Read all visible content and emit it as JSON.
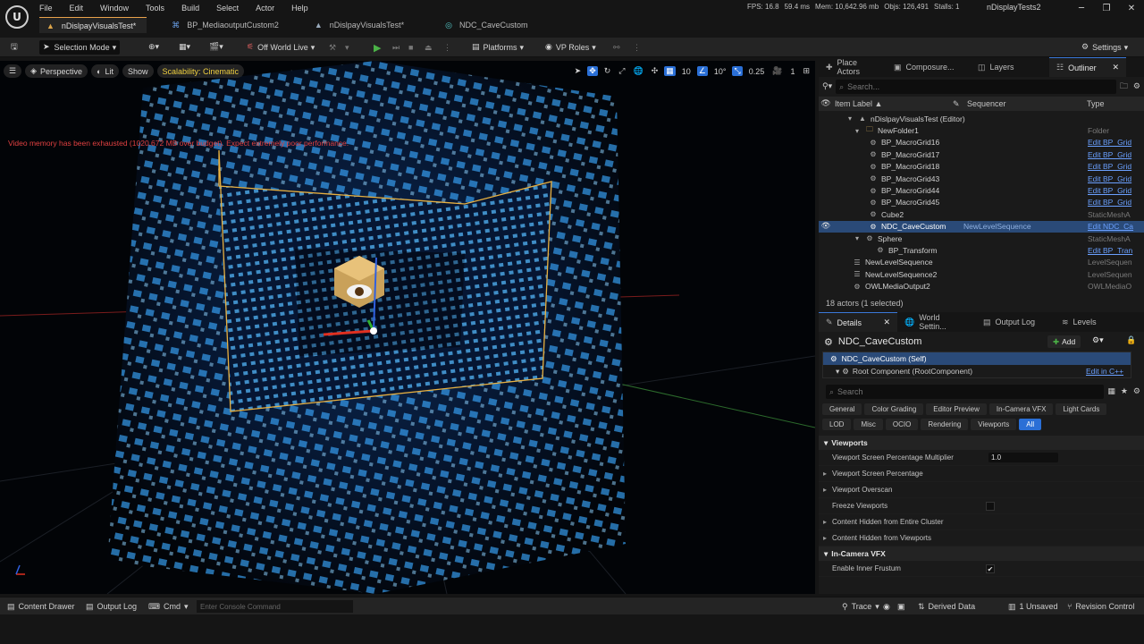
{
  "app": {
    "menu": [
      "File",
      "Edit",
      "Window",
      "Tools",
      "Build",
      "Select",
      "Actor",
      "Help"
    ],
    "stats": {
      "fps": "FPS: 16.8",
      "ms": "59.4 ms",
      "mem": "Mem: 10,642.96 mb",
      "objs": "Objs: 126,491",
      "stalls": "Stalls: 1"
    },
    "project_name": "nDisplayTests2",
    "tabs": [
      {
        "label": "nDislpayVisualsTest*",
        "active": true
      },
      {
        "label": "BP_MediaoutputCustom2",
        "active": false
      },
      {
        "label": "nDislpayVisualsTest*",
        "active": false
      },
      {
        "label": "NDC_CaveCustom",
        "active": false
      }
    ]
  },
  "toolbar": {
    "selection_mode": "Selection Mode",
    "world_live": "Off World Live",
    "platforms": "Platforms",
    "vp_roles": "VP Roles",
    "settings": "Settings"
  },
  "viewport": {
    "perspective": "Perspective",
    "lit": "Lit",
    "show": "Show",
    "scalability": "Scalability: Cinematic",
    "grid_snap": "10",
    "rot_snap": "10°",
    "scale_snap": "0.25",
    "cam_speed": "1",
    "warning": "Video memory has been exhausted (1020.672 MB over budget). Expect extremely poor performance."
  },
  "outliner": {
    "tabs": [
      "Place Actors",
      "Composure...",
      "Layers",
      "Outliner"
    ],
    "search_placeholder": "Search...",
    "col_label": "Item Label",
    "col_sequencer": "Sequencer",
    "col_type": "Type",
    "rows": [
      {
        "label": "nDislpayVisualsTest (Editor)",
        "type": "",
        "link": false
      },
      {
        "label": "NewFolder1",
        "type": "Folder",
        "link": false
      },
      {
        "label": "BP_MacroGrid16",
        "type": "Edit BP_Grid",
        "link": true
      },
      {
        "label": "BP_MacroGrid17",
        "type": "Edit BP_Grid",
        "link": true
      },
      {
        "label": "BP_MacroGrid18",
        "type": "Edit BP_Grid",
        "link": true
      },
      {
        "label": "BP_MacroGrid43",
        "type": "Edit BP_Grid",
        "link": true
      },
      {
        "label": "BP_MacroGrid44",
        "type": "Edit BP_Grid",
        "link": true
      },
      {
        "label": "BP_MacroGrid45",
        "type": "Edit BP_Grid",
        "link": true
      },
      {
        "label": "Cube2",
        "type": "StaticMeshA",
        "link": false
      },
      {
        "label": "NDC_CaveCustom",
        "type": "Edit NDC_Ca",
        "link": true,
        "sequencer": "NewLevelSequence"
      },
      {
        "label": "Sphere",
        "type": "StaticMeshA",
        "link": false
      },
      {
        "label": "BP_Transform",
        "type": "Edit BP_Tran",
        "link": true
      },
      {
        "label": "NewLevelSequence",
        "type": "LevelSequen",
        "link": false
      },
      {
        "label": "NewLevelSequence2",
        "type": "LevelSequen",
        "link": false
      },
      {
        "label": "OWLMediaOutput2",
        "type": "OWLMediaO",
        "link": false
      }
    ],
    "footer": "18 actors (1 selected)"
  },
  "details": {
    "tabs": [
      "Details",
      "World Settin...",
      "Output Log",
      "Levels"
    ],
    "title": "NDC_CaveCustom",
    "add_label": "Add",
    "components": [
      {
        "label": "NDC_CaveCustom (Self)"
      },
      {
        "label": "Root Component (RootComponent)",
        "action": "Edit in C++"
      }
    ],
    "search_placeholder": "Search",
    "filters": [
      "General",
      "Color Grading",
      "Editor Preview",
      "In-Camera VFX",
      "Light Cards",
      "LOD",
      "Misc",
      "OCIO",
      "Rendering",
      "Viewports",
      "All"
    ],
    "active_filter": "All",
    "sections": [
      {
        "name": "Viewports",
        "props": [
          {
            "label": "Viewport Screen Percentage Multiplier",
            "value": "1.0"
          },
          {
            "label": "Viewport Screen Percentage",
            "expandable": true
          },
          {
            "label": "Viewport Overscan",
            "expandable": true
          },
          {
            "label": "Freeze Viewports",
            "checkbox": false
          },
          {
            "label": "Content Hidden from Entire Cluster",
            "expandable": true
          },
          {
            "label": "Content Hidden from Viewports",
            "expandable": true
          }
        ]
      },
      {
        "name": "In-Camera VFX",
        "props": [
          {
            "label": "Enable Inner Frustum",
            "checkbox": true
          }
        ]
      }
    ]
  },
  "bottombar": {
    "content_drawer": "Content Drawer",
    "output_log": "Output Log",
    "cmd": "Cmd",
    "console_placeholder": "Enter Console Command",
    "trace": "Trace",
    "derived_data": "Derived Data",
    "unsaved": "1 Unsaved",
    "revision_control": "Revision Control"
  }
}
